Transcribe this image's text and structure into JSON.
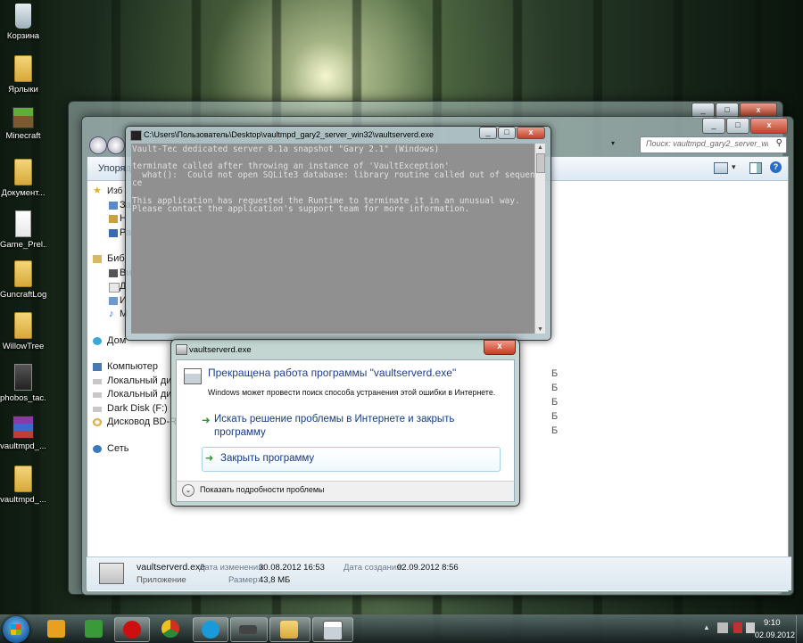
{
  "desktop": {
    "icons": [
      {
        "label": "Корзина",
        "icon": "recycle-bin-icon"
      },
      {
        "label": "Ярлыки",
        "icon": "folder-icon"
      },
      {
        "label": "Minecraft",
        "icon": "minecraft-icon"
      },
      {
        "label": "Документ...",
        "icon": "folder-icon"
      },
      {
        "label": "Game_Prel...",
        "icon": "document-icon"
      },
      {
        "label": "GuncraftLogs",
        "icon": "folder-icon"
      },
      {
        "label": "WillowTree",
        "icon": "folder-icon"
      },
      {
        "label": "phobos_tac...",
        "icon": "image-icon"
      },
      {
        "label": "vaultmpd_...",
        "icon": "winrar-archive-icon"
      },
      {
        "label": "vaultmpd_...",
        "icon": "folder-icon"
      }
    ]
  },
  "explorer": {
    "search_placeholder": "Поиск: vaultmpd_gary2_server_win32",
    "organize_label": "Упоряд",
    "nav_items": [
      {
        "label": "Изб",
        "icon": "star-icon"
      },
      {
        "label": "За",
        "icon": "downloads-icon"
      },
      {
        "label": "Н",
        "icon": "recent-places-icon"
      },
      {
        "label": "Ра",
        "icon": "desktop-icon"
      },
      {
        "label": "Биб",
        "icon": "library-icon"
      },
      {
        "label": "Ви",
        "icon": "video-icon"
      },
      {
        "label": "Д",
        "icon": "documents-icon"
      },
      {
        "label": "И",
        "icon": "pictures-icon"
      },
      {
        "label": "М",
        "icon": "music-icon"
      },
      {
        "label": "Дом",
        "icon": "homegroup-icon"
      },
      {
        "label": "Компьютер",
        "icon": "computer-icon"
      },
      {
        "label": "Локальный ди",
        "icon": "drive-icon"
      },
      {
        "label": "Локальный ди",
        "icon": "drive-icon"
      },
      {
        "label": "Dark Disk (F:)",
        "icon": "drive-icon"
      },
      {
        "label": "Дисковод BD-R",
        "icon": "bd-drive-icon"
      },
      {
        "label": "Сеть",
        "icon": "network-icon"
      }
    ],
    "size_column_glyph": "Б",
    "details": {
      "name": "vaultserverd.exe",
      "type": "Приложение",
      "modified_label": "Дата изменения:",
      "modified_value": "30.08.2012 16:53",
      "created_label": "Дата создания:",
      "created_value": "02.09.2012 8:56",
      "size_label": "Размер:",
      "size_value": "43,8 МБ"
    }
  },
  "console": {
    "title": "C:\\Users\\Пользователь\\Desktop\\vaultmpd_gary2_server_win32\\vaultserverd.exe",
    "lines": [
      "Vault-Tec dedicated server 0.1a snapshot \"Gary 2.1\" (Windows)",
      "",
      "terminate called after throwing an instance of 'VaultException'",
      "  what():  Could not open SQLite3 database: library routine called out of sequen",
      "ce",
      "",
      "This application has requested the Runtime to terminate it in an unusual way.",
      "Please contact the application's support team for more information."
    ]
  },
  "dialog": {
    "title": "vaultserverd.exe",
    "heading": "Прекращена работа программы \"vaultserverd.exe\"",
    "subtext": "Windows может провести поиск способа устранения этой ошибки в Интернете.",
    "option_search_line1": "Искать решение проблемы в Интернете и закрыть",
    "option_search_line2": "программу",
    "option_close": "Закрыть программу",
    "details_toggle": "Показать подробности проблемы",
    "close_glyph": "x"
  },
  "taskbar": {
    "time": "9:10",
    "date": "02.09.2012",
    "apps": [
      {
        "name": "media-player-icon",
        "color": "#e8a020"
      },
      {
        "name": "task-manager-icon",
        "color": "#3a9a3a"
      },
      {
        "name": "opera-icon",
        "color": "#cc1010"
      },
      {
        "name": "chrome-icon",
        "color": "#2a8a3a"
      },
      {
        "name": "skype-icon",
        "color": "#1a9ad8"
      },
      {
        "name": "console-app-icon",
        "color": "#444444"
      },
      {
        "name": "explorer-folder-icon",
        "color": "#e8c050"
      },
      {
        "name": "error-app-icon",
        "color": "#dddddd"
      }
    ]
  }
}
